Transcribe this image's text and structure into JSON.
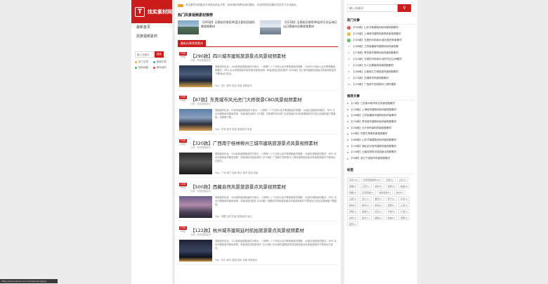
{
  "sidebar": {
    "logo_mark": "T",
    "logo_text": "炫实素材网",
    "nav": [
      "最新首页",
      "风景视频素材"
    ],
    "search_placeholder": "输入关键字",
    "search_button": "搜索",
    "quick_links": [
      {
        "label": "热门文章",
        "color": "#f0b020"
      },
      {
        "label": "推荐文章",
        "color": "#3aa0e6"
      },
      {
        "label": "网站地图",
        "color": "#42b94d"
      },
      {
        "label": "联系我们",
        "color": "#e0434a"
      }
    ]
  },
  "main": {
    "notice": "本站素材均收集自于网络及网友共享，如有侵权请联系我们删除，本站所提供的素材仅供学习交流使用。",
    "hot_title": "热门风景视频素材推荐",
    "recommend": [
      {
        "title": "【305款】无损拍可商用4K蓝天航拍西湖风景视频素材"
      },
      {
        "title": "【321款】无损拍可商用4K延时天空云海日出日落城市风景视频素材"
      }
    ],
    "latest_tab": "最新风景视频素材",
    "articles": [
      {
        "month": "03月",
        "day": "09日",
        "title": "【290款】四川城市建筑旅游景点风景视频素材",
        "category": "分类：风景视频素材",
        "summary": "视频素材包含：290部风景视频素材分别为：八桥等+八个分钟以及不等视频素材规格：1080P(30帧)以及不等规格各种格式：MP4 无水印视频素材选项部分使用说明：风景/航拍/旅游/城市【290款】四川城市建筑旅游景点风景视频素材下载地址已给出。",
        "tags": "Tag：四川 城市 旅游 风景 视频素材"
      },
      {
        "month": "03月",
        "day": "09日",
        "title": "【87款】东莞城市风光虎门大桥夜景CBD风景视频素材",
        "category": "分类：风景视频素材",
        "summary": "视频素材包含：87部风景视频素材分别为：八桥等+八个分钟以及不等视频素材规格：4K蓝光视频素材格式：MP4 无水印视频素材使用说明：风景/航拍/城市【87款】东莞城市风光虎门大桥夜景CBD风景视频素材已给出百度网盘下载链接，请按需下载。",
        "tags": "Tag：东莞 城市 风景 视频素材 夜景"
      },
      {
        "month": "03月",
        "day": "09日",
        "title": "【320款】广西南宁桂林柳州三城市建筑旅游景点风景视频素材",
        "category": "分类：风景视频素材",
        "summary": "视频素材包含：320部风景视频素材分别为：八桥等+八个分钟以及不等视频素材规格：4K蓝光视频素材格式：MP4 无水印视频素材使用说明：风景/航拍/旅游/城市【320款】广西南宁桂林柳州三城市建筑旅游景点风景视频素材下载地址已给出。",
        "tags": "Tag：广西 南宁 桂林 柳州 城市 旅游 风景"
      },
      {
        "month": "03月",
        "day": "09日",
        "title": "【500款】西藏自然风景旅游景点风景视频素材",
        "category": "分类：风景视频素材",
        "summary": "视频素材包含：500部风景视频素材分别为：八桥等+八个分钟以及不等视频素材规格：4K蓝光视频素材格式：MP4 无水印视频素材使用说明：风景/航拍/旅游【500款】西藏自然风景旅游景点风景视频素材下载地址已给出百度网盘下载链接。",
        "tags": "Tag：西藏 自然 风景 视频素材 景点"
      },
      {
        "month": "03月",
        "day": "09日",
        "title": "【122款】杭州城市建筑延时航拍旅游景点风景视频素材",
        "category": "分类：风景视频素材",
        "summary": "视频素材包含：122部风景视频素材分别为：八桥等+八个分钟以及不等视频素材规格：4K蓝光视频素材格式：MP4 无水印视频素材使用说明：风景/航拍/旅游/城市【122款】杭州城市建筑延时航拍旅游景点风景视频素材下载地址已给出。",
        "tags": "Tag：杭州 城市 建筑 航拍 风景 视频素材"
      }
    ]
  },
  "right": {
    "search_placeholder": "输入关键词",
    "hot_title": "热门文章",
    "hot": [
      {
        "n": "1",
        "text": "【290款】山东济南建筑地标风景视频素材",
        "color": "#e0434a"
      },
      {
        "n": "2",
        "text": "【129款】上海城市建筑陆家嘴风景视频素材",
        "color": "#f0b020"
      },
      {
        "n": "3",
        "text": "【305款】无损拍可商用4K蓝天航拍风景素材",
        "color": "#42b94d"
      },
      {
        "n": "4",
        "text": "【168款】江苏南通城市建筑地标风景视频",
        "color": ""
      },
      {
        "n": "5",
        "text": "【176款】青岛城市建筑地标风景视频素材",
        "color": ""
      },
      {
        "n": "6",
        "text": "【321款】无损拍可商用4K延时天空云海素材",
        "color": ""
      },
      {
        "n": "7",
        "text": "【152款】天火石屏森林风景视频素材",
        "color": ""
      },
      {
        "n": "8",
        "text": "【208款】云南丽江古城旅游风景视频素材",
        "color": ""
      },
      {
        "n": "9",
        "text": "【272款】无锡城市风景视频素材",
        "color": ""
      },
      {
        "n": "10",
        "text": "【279款】广西南宁桂林柳州三城市建筑",
        "color": ""
      }
    ],
    "recommend_title": "推荐文章",
    "recommend": [
      "【27款】江苏常州城市风光风景视频素材",
      "【128款】上海城市建筑地标风景视频素材",
      "【108款】江苏南通城市建筑地标风景素材",
      "【176款】青岛城市建筑地标风景视频素材",
      "【158款】大兴安岭森林风景视频素材",
      "【43款】内蒙古草原风景视频素材",
      "【288款】山东济南建筑地标风景视频素材",
      "【118款】湖北武汉城市建筑风景视频素材",
      "【144款】云南自然风光旅游景点视频素材",
      "【90款】浙江宁波城市风景视频素材"
    ],
    "tags_title": "标签",
    "tags": [
      "风景(19)",
      "风景视频素材(19)",
      "云南(5)",
      "山东(3)",
      "西藏(3)",
      "江苏(3)",
      "城市(5)",
      "旅游(4)",
      "航拍(4)",
      "成都(2)",
      "天空视频(2)",
      "城市建筑(2)",
      "杭州(1)",
      "山西(1)",
      "四川(1)",
      "重庆(1)",
      "南宁(1)",
      "东莞(1)",
      "桂林(1)",
      "柳州(1)",
      "青岛(1)",
      "合肥(1)",
      "上海(1)",
      "济南(1)",
      "南通(1)",
      "武汉(1)",
      "宁波(1)",
      "广西(1)",
      "拉萨(1)",
      "贵州(1)",
      "福建(1)",
      "航拍(1)",
      "海南(1)",
      "夜景(1)"
    ]
  },
  "status_url": "https://www.xshisucai.com/shipin/fengjing/"
}
